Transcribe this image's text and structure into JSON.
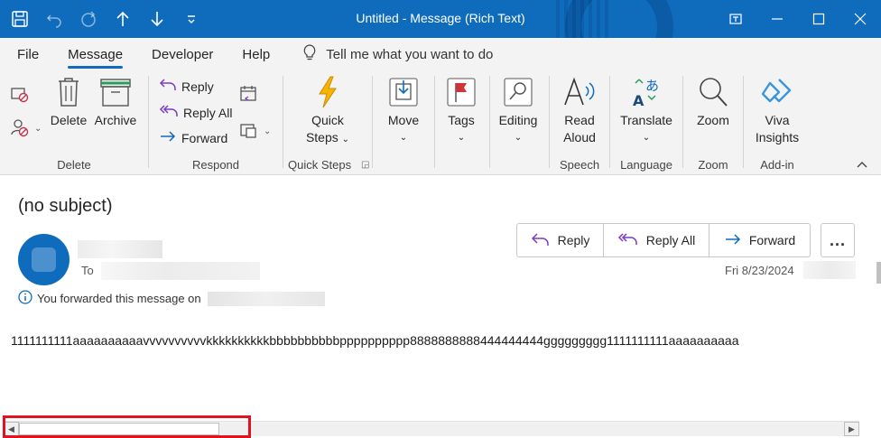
{
  "window": {
    "title": "Untitled  -  Message (Rich Text)",
    "qat_icons": [
      "save-icon",
      "undo-icon",
      "redo-icon",
      "up-arrow-icon",
      "down-arrow-icon",
      "customize-qat-icon"
    ],
    "controls": [
      "restore-ribbon-icon",
      "minimize-icon",
      "maximize-icon",
      "close-icon"
    ]
  },
  "menu": {
    "tabs": [
      "File",
      "Message",
      "Developer",
      "Help"
    ],
    "active_tab": "Message",
    "tell_me": "Tell me what you want to do"
  },
  "ribbon": {
    "delete_group": {
      "label": "Delete",
      "delete": "Delete",
      "archive": "Archive"
    },
    "respond_group": {
      "label": "Respond",
      "reply": "Reply",
      "reply_all": "Reply All",
      "forward": "Forward"
    },
    "quick_steps_group": {
      "label": "Quick Steps",
      "quick": "Quick",
      "steps": "Steps"
    },
    "move": "Move",
    "tags": "Tags",
    "editing": "Editing",
    "speech_group": {
      "label": "Speech",
      "read": "Read",
      "aloud": "Aloud"
    },
    "language_group": {
      "label": "Language",
      "translate": "Translate"
    },
    "zoom_group": {
      "label": "Zoom",
      "zoom": "Zoom"
    },
    "addin_group": {
      "label": "Add-in",
      "viva": "Viva",
      "insights": "Insights"
    }
  },
  "message": {
    "subject": "(no subject)",
    "to_label": "To",
    "forward_info": "You forwarded this message on",
    "date": "Fri 8/23/2024",
    "body": "1111111111aaaaaaaaaavvvvvvvvvvkkkkkkkkkkbbbbbbbbbbpppppppppp8888888888444444444ggggggggg1111111111aaaaaaaaaa"
  },
  "actions": {
    "reply": "Reply",
    "reply_all": "Reply All",
    "forward": "Forward",
    "more": "..."
  },
  "colors": {
    "brand": "#0f6cbd",
    "highlight": "#e0141e"
  }
}
